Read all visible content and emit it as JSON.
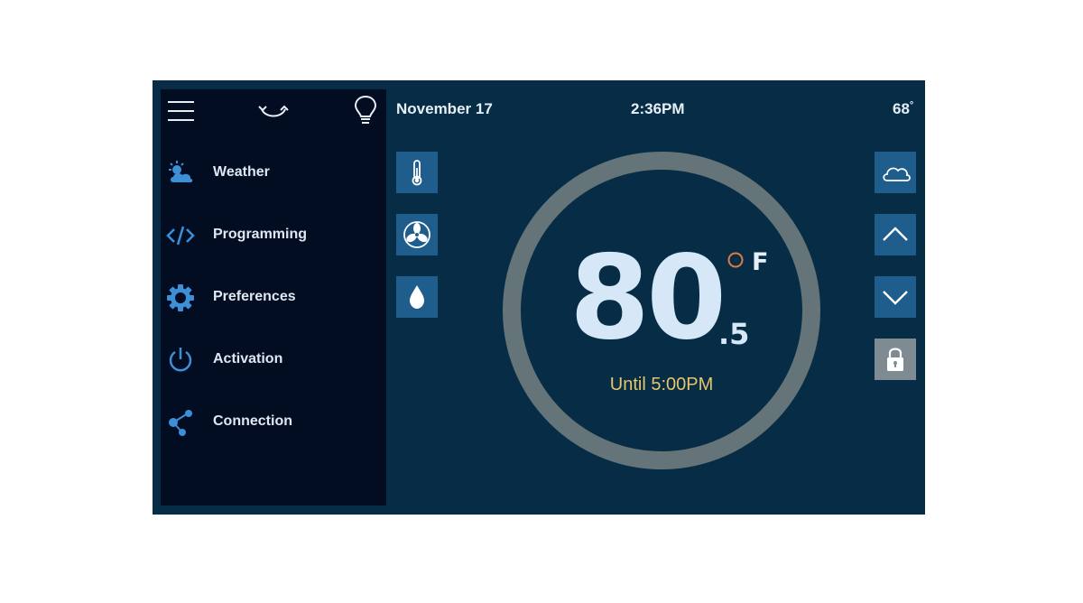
{
  "header": {
    "date": "November 17",
    "time": "2:36PM",
    "outdoor_temp": "68",
    "outdoor_temp_unit": "°"
  },
  "toolbar": {
    "icons": [
      "hamburger-menu-icon",
      "mode-swap-icon",
      "lightbulb-icon"
    ]
  },
  "sidebar": {
    "items": [
      {
        "label": "Weather",
        "icon": "weather-cloud-sun-icon"
      },
      {
        "label": "Programming",
        "icon": "code-brackets-icon"
      },
      {
        "label": "Preferences",
        "icon": "gear-icon"
      },
      {
        "label": "Activation",
        "icon": "power-icon"
      },
      {
        "label": "Connection",
        "icon": "share-nodes-icon"
      }
    ]
  },
  "left_controls": [
    "thermometer-icon",
    "fan-icon",
    "humidity-drop-icon"
  ],
  "right_controls": [
    "cloud-icon",
    "chevron-up-icon",
    "chevron-down-icon",
    "lock-icon"
  ],
  "thermostat": {
    "set_temp": "80",
    "set_temp_decimal": ".5",
    "unit": "F",
    "until_text": "Until 5:00PM"
  },
  "colors": {
    "screen_bg": "#062d45",
    "sidebar_bg": "#020d22",
    "tile_bg": "#1e5d8c",
    "lock_tile_bg": "#7e8b92",
    "ring": "#657479",
    "accent_icon": "#3d8fd8",
    "temp_text": "#d6e8f8",
    "until_text": "#e5c56a",
    "degree_circle": "#e07a4a"
  }
}
